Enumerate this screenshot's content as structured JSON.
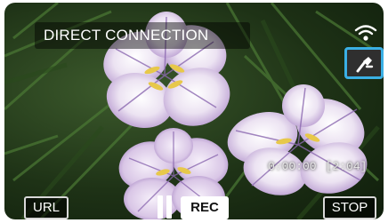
{
  "header": {
    "title": "DIRECT CONNECTION"
  },
  "status": {
    "wifi_icon": "wifi-icon",
    "mode_icon": "direct-connection-icon"
  },
  "recording": {
    "elapsed": "0:00:00",
    "remaining": "[2:04]"
  },
  "controls": {
    "url_label": "URL",
    "pause_icon": "pause-icon",
    "rec_label": "REC",
    "stop_label": "STOP"
  },
  "colors": {
    "highlight_border": "#3ab0e5",
    "button_border": "#d8d8d8"
  }
}
